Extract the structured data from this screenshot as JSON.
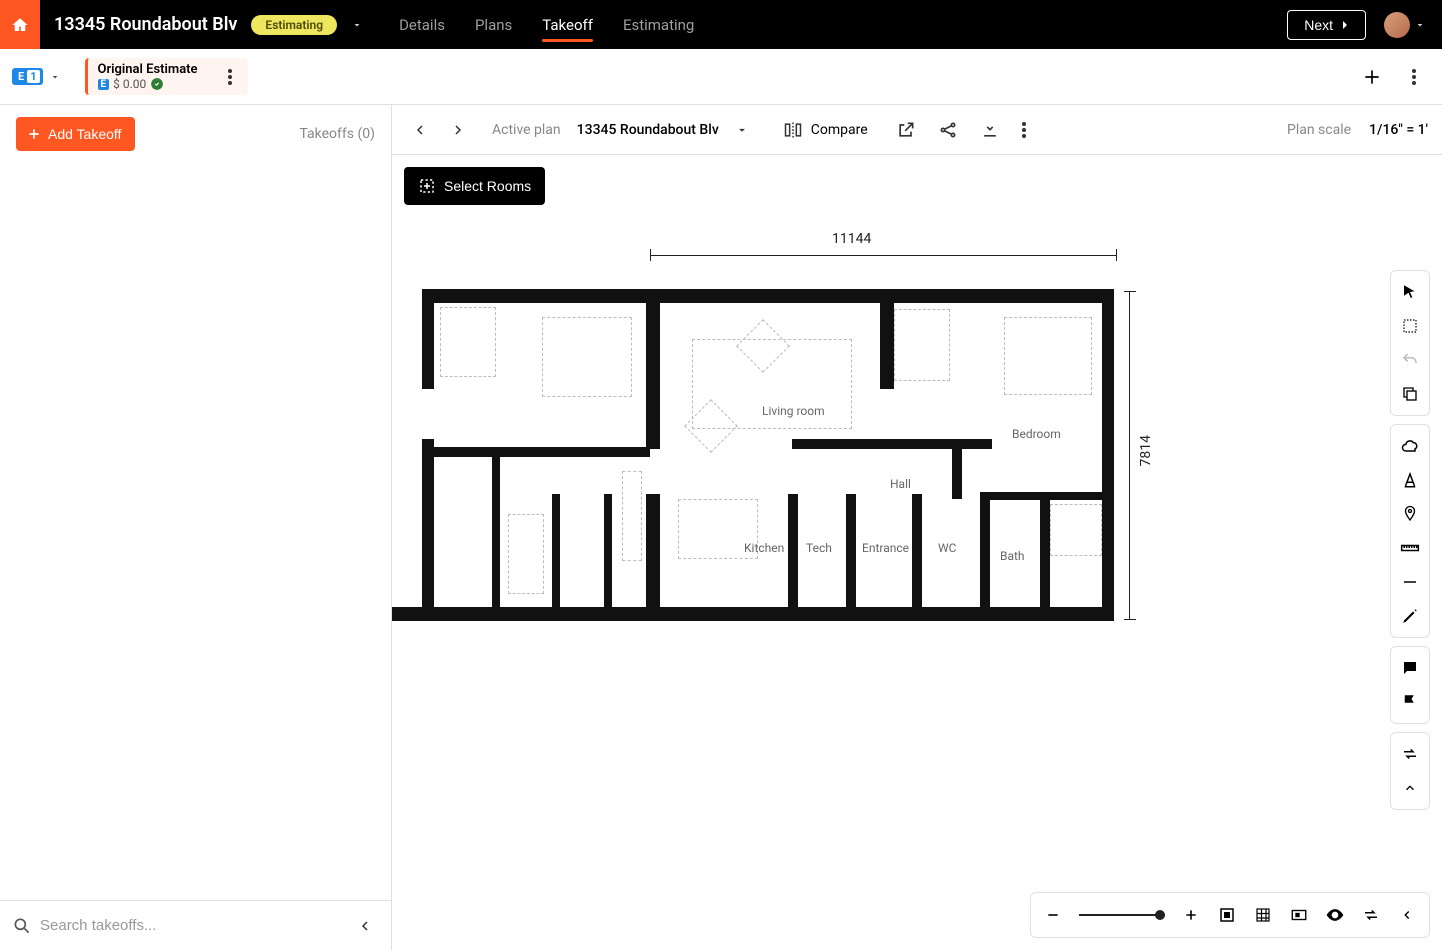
{
  "topbar": {
    "project_title": "13345 Roundabout Blv",
    "status": "Estimating",
    "tabs": [
      {
        "label": "Details",
        "active": false
      },
      {
        "label": "Plans",
        "active": false
      },
      {
        "label": "Takeoff",
        "active": true
      },
      {
        "label": "Estimating",
        "active": false
      }
    ],
    "next_label": "Next"
  },
  "secondbar": {
    "estimate_chip": "E 1",
    "estimate_title": "Original Estimate",
    "estimate_badge": "E",
    "estimate_amount": "$ 0.00"
  },
  "left_panel": {
    "add_button": "Add Takeoff",
    "count_label": "Takeoffs (0)",
    "search_placeholder": "Search takeoffs..."
  },
  "tertiary": {
    "active_plan_prefix": "Active plan",
    "active_plan_name": "13345 Roundabout Blv",
    "compare_label": "Compare",
    "plan_scale_prefix": "Plan scale",
    "plan_scale_value": "1/16\" = 1'"
  },
  "canvas": {
    "select_rooms_label": "Select Rooms",
    "dim_horizontal": "11144",
    "dim_vertical": "7814",
    "rooms": {
      "living_room": "Living room",
      "bedroom": "Bedroom",
      "hall": "Hall",
      "kitchen": "Kitchen",
      "tech": "Tech",
      "entrance": "Entrance",
      "wc": "WC",
      "bath": "Bath"
    }
  }
}
